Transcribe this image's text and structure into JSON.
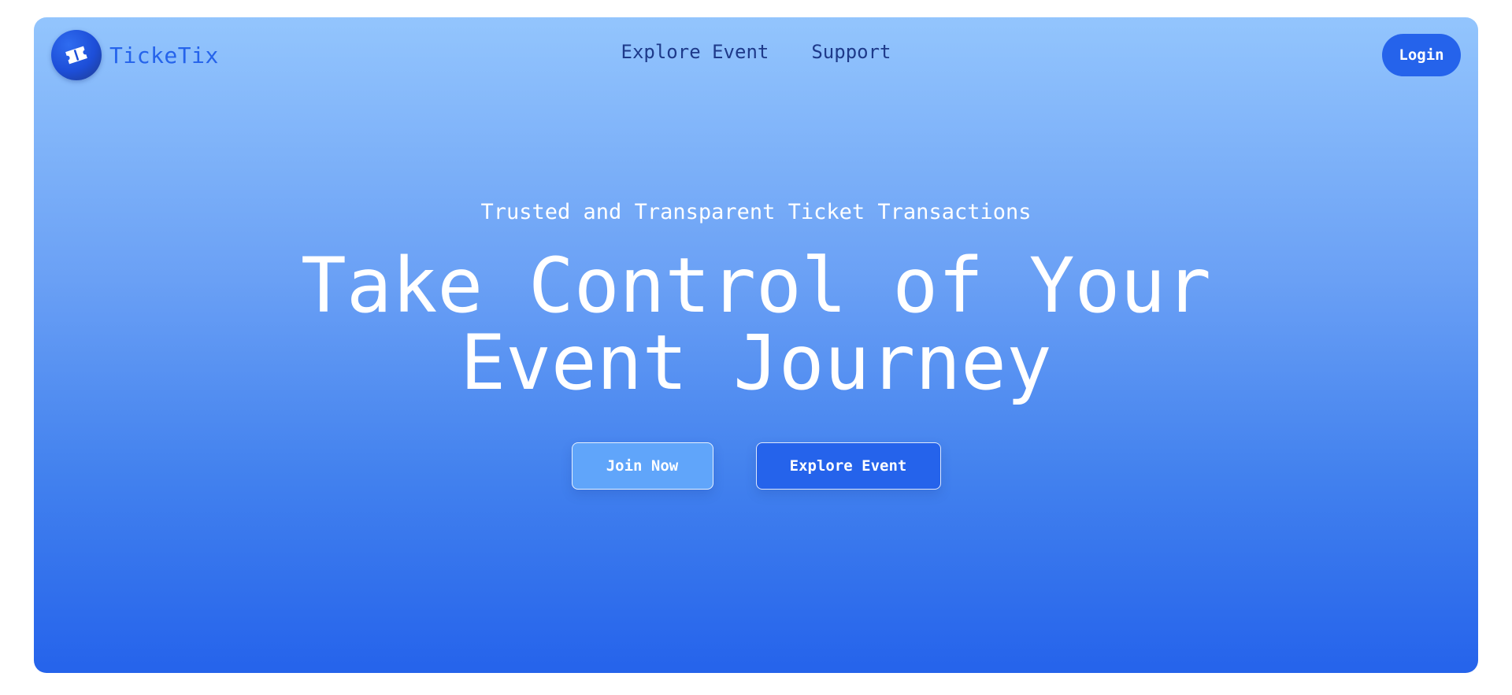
{
  "brand": {
    "name": "TickeTix",
    "logo_icon": "ticket-icon"
  },
  "nav": {
    "links": [
      {
        "label": "Explore Event"
      },
      {
        "label": "Support"
      }
    ],
    "login_label": "Login"
  },
  "hero": {
    "tagline": "Trusted and Transparent Ticket Transactions",
    "headline_line1": "Take Control of Your",
    "headline_line2": "Event Journey",
    "join_label": "Join Now",
    "explore_label": "Explore Event"
  },
  "colors": {
    "primary": "#2563eb",
    "light_blue": "#93c5fd",
    "nav_text": "#1e3a8a",
    "join_button": "#60a5fa"
  }
}
